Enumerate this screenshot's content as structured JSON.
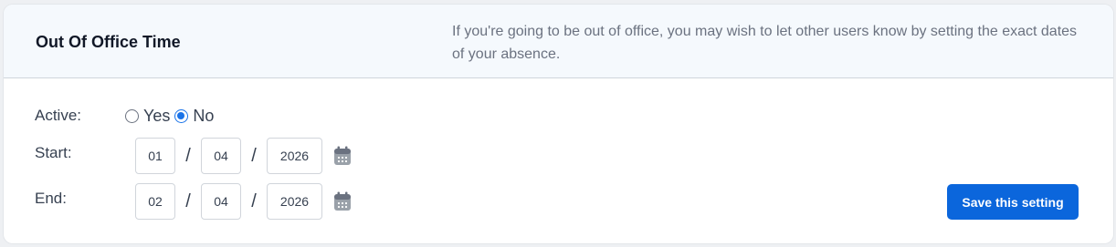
{
  "header": {
    "title": "Out Of Office Time",
    "description": "If you're going to be out of office, you may wish to let other users know by setting the exact dates of your absence."
  },
  "form": {
    "active": {
      "label": "Active:",
      "options": [
        {
          "label": "Yes",
          "checked": false
        },
        {
          "label": "No",
          "checked": true
        }
      ]
    },
    "start": {
      "label": "Start:",
      "day": "01",
      "month": "04",
      "year": "2026"
    },
    "end": {
      "label": "End:",
      "day": "02",
      "month": "04",
      "year": "2026"
    },
    "separator": "/",
    "calendar_icon": "calendar-icon"
  },
  "actions": {
    "save_label": "Save this setting"
  },
  "colors": {
    "primary": "#0b66dc",
    "header_bg": "#f5f9fd",
    "radio_accent": "#1a73e8"
  }
}
